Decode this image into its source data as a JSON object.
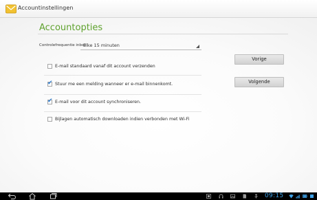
{
  "actionbar": {
    "title": "Accountinstellingen",
    "icon": "email-app-icon"
  },
  "page": {
    "title": "Accountopties"
  },
  "frequency": {
    "label": "Controlefrequentie inbox",
    "value": "Elke 15 minuten"
  },
  "prefs": [
    {
      "label": "E-mail standaard vanaf dit account verzenden",
      "checked": false
    },
    {
      "label": "Stuur me een melding wanneer er e-mail binnenkomt.",
      "checked": true
    },
    {
      "label": "E-mail voor dit account synchroniseren.",
      "checked": true
    },
    {
      "label": "Bijlagen automatisch downloaden indien verbonden met Wi-Fi",
      "checked": false
    }
  ],
  "buttons": {
    "previous": "Vorige",
    "next": "Volgende"
  },
  "statusbar": {
    "time": "09:15",
    "accent_color": "#3fa2e8",
    "icons": [
      "back-icon",
      "home-icon",
      "recent-apps-icon",
      "screenshot-icon",
      "headset-icon",
      "gallery-icon",
      "sd-card-icon",
      "usb-icon",
      "wifi-icon",
      "battery-icon"
    ]
  },
  "colors": {
    "title_green": "#5fa22e",
    "check_blue": "#2f7fd2"
  }
}
